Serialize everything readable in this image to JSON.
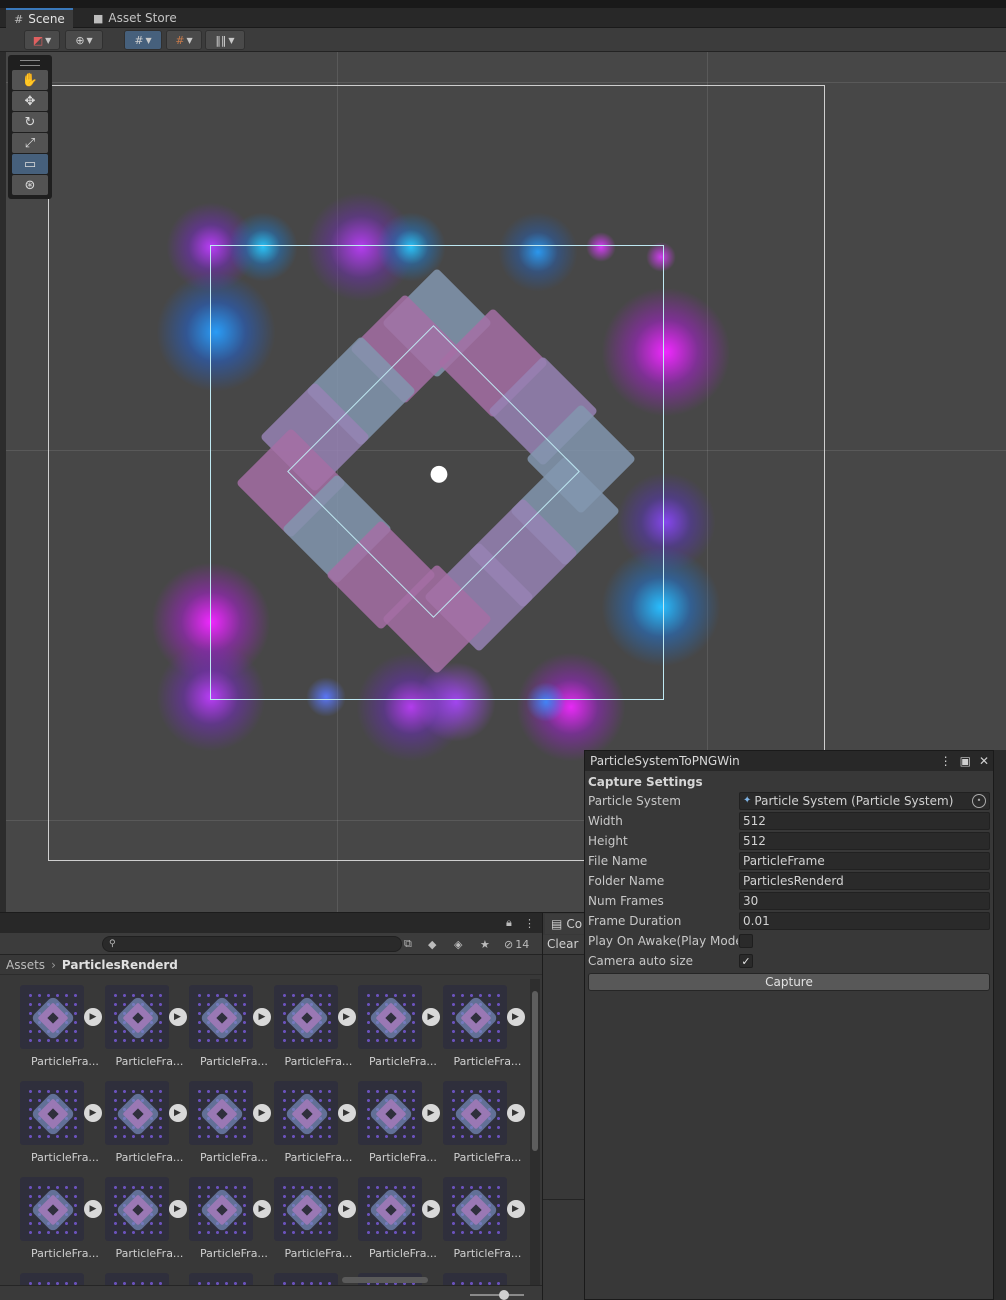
{
  "tabs": [
    {
      "label": "Scene",
      "icon": "grid-icon"
    },
    {
      "label": "Asset Store",
      "icon": "bag-icon"
    }
  ],
  "scene_toolbar": {
    "buttons": [
      "draw-mode-icon",
      "globe-icon",
      "grid-snap-icon",
      "snap-increment-icon",
      "ruler-icon"
    ]
  },
  "tools": [
    "hand-tool-icon",
    "move-tool-icon",
    "rotate-tool-icon",
    "scale-tool-icon",
    "rect-tool-icon",
    "transform-tool-icon"
  ],
  "particle_window": {
    "title": "ParticleSystemToPNGWin",
    "section": "Capture Settings",
    "fields": [
      {
        "label": "Particle System",
        "value": "Particle System (Particle System)"
      },
      {
        "label": "Width",
        "value": "512"
      },
      {
        "label": "Height",
        "value": "512"
      },
      {
        "label": "File Name",
        "value": "ParticleFrame"
      },
      {
        "label": "Folder Name",
        "value": "ParticlesRenderd"
      },
      {
        "label": "Num Frames",
        "value": "30"
      },
      {
        "label": "Frame Duration",
        "value": "0.01"
      }
    ],
    "play_on_awake_label": "Play On Awake(Play Mode",
    "play_on_awake_checked": false,
    "camera_auto_size_label": "Camera auto size",
    "camera_auto_size_checked": true,
    "capture_label": "Capture"
  },
  "project": {
    "hidden_count": "14",
    "breadcrumb_root": "Assets",
    "breadcrumb_current": "ParticlesRenderd",
    "item_label": "ParticleFra..."
  },
  "console": {
    "tab_label": "Co",
    "clear_label": "Clear"
  }
}
